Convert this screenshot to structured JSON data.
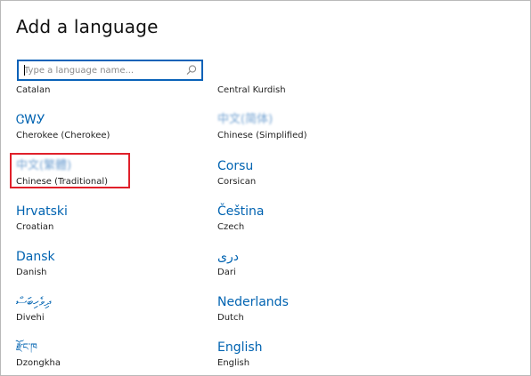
{
  "dialog": {
    "title": "Add a language"
  },
  "search": {
    "placeholder": "Type a language name..."
  },
  "languages": [
    {
      "english": "Catalan"
    },
    {
      "english": "Central Kurdish"
    },
    {
      "native": "ᏣᎳᎩ",
      "english": "Cherokee (Cherokee)"
    },
    {
      "native": "中文(简体)",
      "english": "Chinese (Simplified)"
    },
    {
      "native": "中文(繁體)",
      "english": "Chinese (Traditional)"
    },
    {
      "native": "Corsu",
      "english": "Corsican"
    },
    {
      "native": "Hrvatski",
      "english": "Croatian"
    },
    {
      "native": "Čeština",
      "english": "Czech"
    },
    {
      "native": "Dansk",
      "english": "Danish"
    },
    {
      "native": "دری",
      "english": "Dari"
    },
    {
      "native": "ދިވެހިބަސް",
      "english": "Divehi"
    },
    {
      "native": "Nederlands",
      "english": "Dutch"
    },
    {
      "native": "རྫོང་ཁ",
      "english": "Dzongkha"
    },
    {
      "native": "English",
      "english": "English"
    }
  ],
  "colors": {
    "accent": "#0063b1",
    "highlight": "#e0202a"
  },
  "icons": {
    "search": "search-icon"
  }
}
